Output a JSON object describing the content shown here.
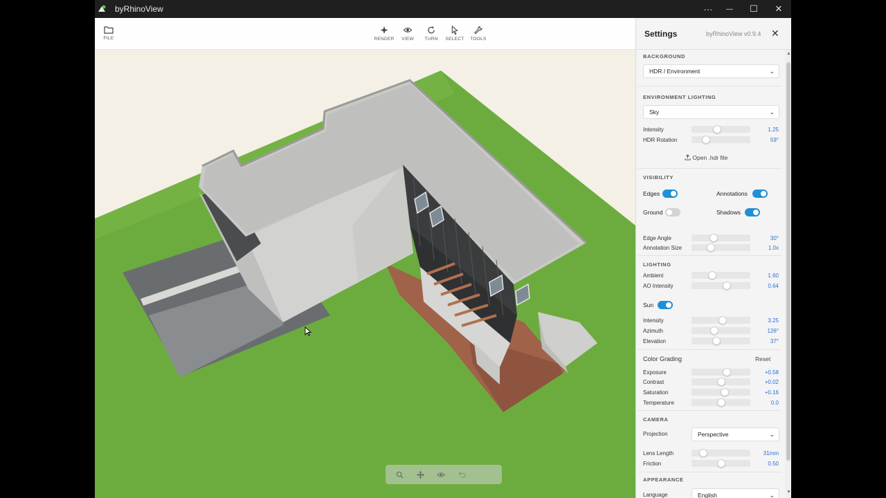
{
  "window": {
    "title": "byRhinoView",
    "controls": {
      "more": "···",
      "minimize": "—",
      "maximize": "☐",
      "close": "✕"
    }
  },
  "toolbar": {
    "file": "FILE",
    "render": "RENDER",
    "view": "VIEW",
    "turn": "TURN",
    "select": "SELECT",
    "tools": "TOOLS"
  },
  "settings": {
    "title": "Settings",
    "version": "byRhinoView v0.9.4",
    "close": "✕",
    "background": {
      "section": "BACKGROUND",
      "value": "HDR / Environment"
    },
    "env": {
      "section": "ENVIRONMENT LIGHTING",
      "value": "Sky",
      "intensity_label": "Intensity",
      "intensity_value": "1.25",
      "intensity_level": 0.43,
      "rotation_label": "HDR Rotation",
      "rotation_value": "59°",
      "rotation_level": 0.2,
      "open_hdr": "Open .hdr file"
    },
    "visibility": {
      "section": "VISIBILITY",
      "edges": "Edges",
      "edges_on": true,
      "annotations": "Annotations",
      "annotations_on": true,
      "ground": "Ground",
      "ground_on": false,
      "shadows": "Shadows",
      "shadows_on": true,
      "edge_angle_label": "Edge Angle",
      "edge_angle_value": "30°",
      "edge_angle_level": 0.35,
      "annotation_size_label": "Annotation Size",
      "annotation_size_value": "1.0x",
      "annotation_size_level": 0.3
    },
    "lighting": {
      "section": "LIGHTING",
      "ambient_label": "Ambient",
      "ambient_value": "1.60",
      "ambient_level": 0.33,
      "ao_label": "AO Intensity",
      "ao_value": "0.64",
      "ao_level": 0.62,
      "sun": "Sun",
      "sun_on": true,
      "sun_intensity_label": "Intensity",
      "sun_intensity_value": "3.25",
      "sun_intensity_level": 0.54,
      "azimuth_label": "Azimuth",
      "azimuth_value": "126°",
      "azimuth_level": 0.37,
      "elevation_label": "Elevation",
      "elevation_value": "37°",
      "elevation_level": 0.41
    },
    "grading": {
      "title": "Color Grading",
      "reset": "Reset",
      "exposure_label": "Exposure",
      "exposure_value": "+0.58",
      "exposure_level": 0.62,
      "contrast_label": "Contrast",
      "contrast_value": "+0.02",
      "contrast_level": 0.51,
      "saturation_label": "Saturation",
      "saturation_value": "+0.16",
      "saturation_level": 0.57,
      "temperature_label": "Temperature",
      "temperature_value": "0.0",
      "temperature_level": 0.5
    },
    "camera": {
      "section": "CAMERA",
      "projection_label": "Projection",
      "projection_value": "Perspective",
      "lens_label": "Lens Length",
      "lens_value": "31mm",
      "lens_level": 0.15,
      "friction_label": "Friction",
      "friction_value": "0.50",
      "friction_level": 0.5
    },
    "appearance": {
      "section": "APPEARANCE",
      "language_label": "Language",
      "language_value": "English"
    }
  },
  "colors": {
    "accent": "#1f8fd6",
    "value_text": "#2b6fd6",
    "grass": "#6cac3e",
    "deck": "#a0634a"
  }
}
